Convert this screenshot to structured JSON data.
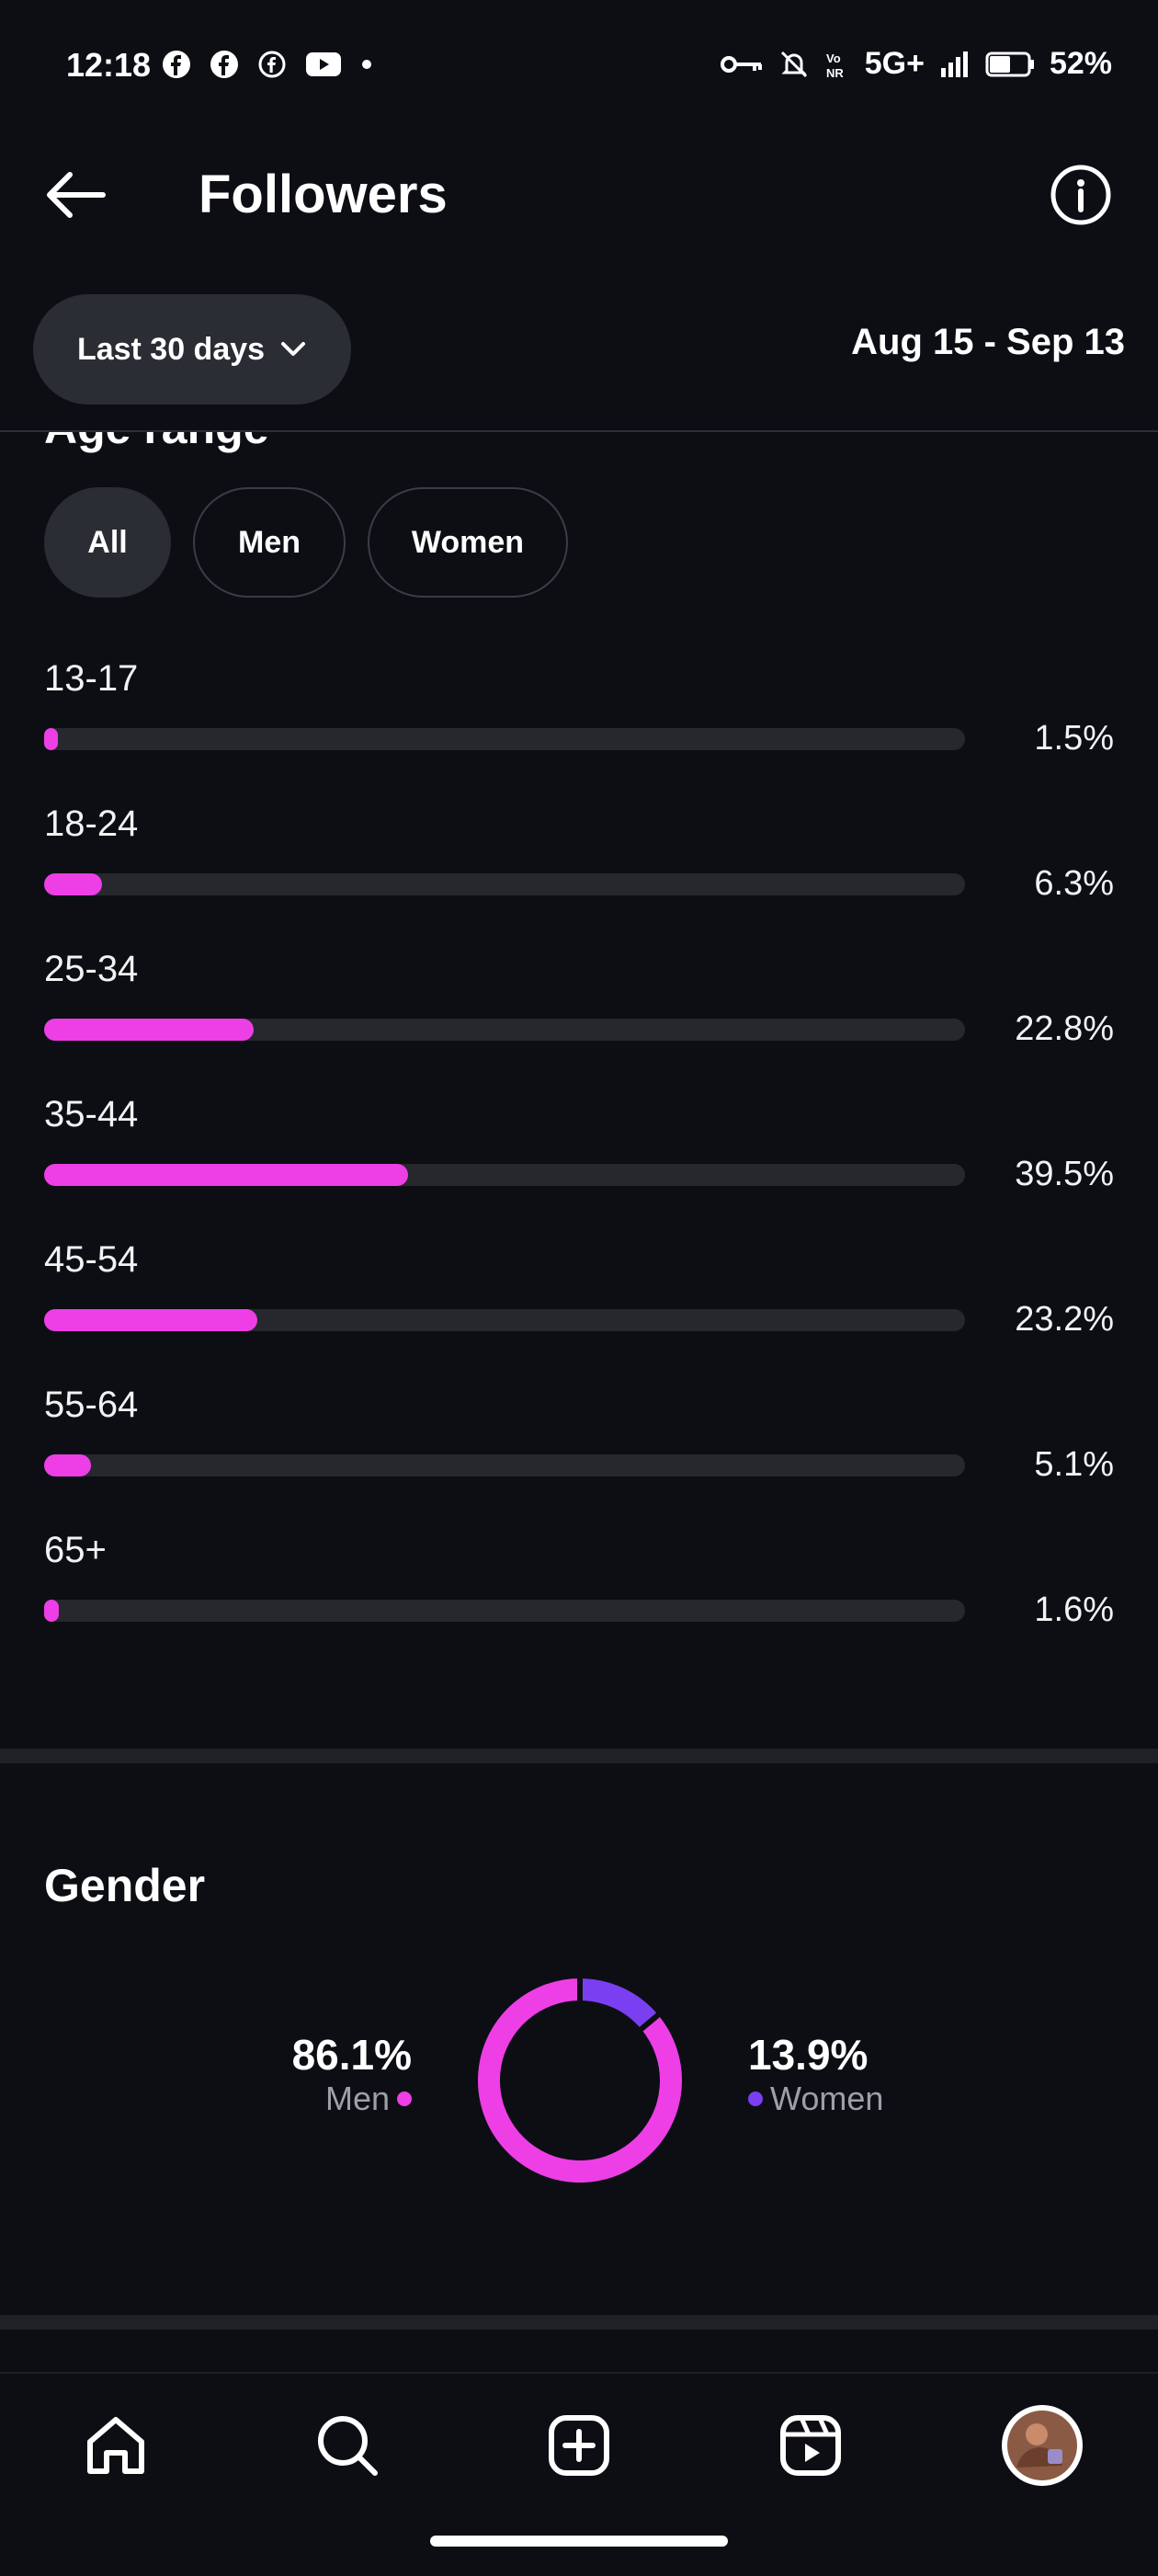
{
  "status_bar": {
    "time": "12:18",
    "network": "5G+",
    "battery": "52%",
    "icons_left": [
      "facebook-icon",
      "facebook-icon",
      "facebook-outline-icon",
      "youtube-icon",
      "dot-icon"
    ],
    "icons_right": [
      "key-icon",
      "bell-off-icon",
      "vonr-icon",
      "signal-icon",
      "battery-icon"
    ]
  },
  "header": {
    "title": "Followers"
  },
  "date_filter": {
    "label": "Last 30 days",
    "range": "Aug 15 - Sep 13"
  },
  "age_range": {
    "heading": "Age range",
    "tabs": [
      {
        "label": "All",
        "active": true
      },
      {
        "label": "Men",
        "active": false
      },
      {
        "label": "Women",
        "active": false
      }
    ],
    "rows": [
      {
        "label": "13-17",
        "value": 1.5,
        "text": "1.5%"
      },
      {
        "label": "18-24",
        "value": 6.3,
        "text": "6.3%"
      },
      {
        "label": "25-34",
        "value": 22.8,
        "text": "22.8%"
      },
      {
        "label": "35-44",
        "value": 39.5,
        "text": "39.5%"
      },
      {
        "label": "45-54",
        "value": 23.2,
        "text": "23.2%"
      },
      {
        "label": "55-64",
        "value": 5.1,
        "text": "5.1%"
      },
      {
        "label": "65+",
        "value": 1.6,
        "text": "1.6%"
      }
    ]
  },
  "gender": {
    "heading": "Gender",
    "men": {
      "value": "86.1%",
      "label": "Men",
      "fraction": 0.861
    },
    "women": {
      "value": "13.9%",
      "label": "Women",
      "fraction": 0.139
    }
  },
  "colors": {
    "accent_pink": "#ee3ee6",
    "accent_purple": "#7b3ff2",
    "background": "#0c0e14"
  },
  "bottom_nav": [
    "home-icon",
    "search-icon",
    "create-icon",
    "reels-icon",
    "profile-avatar"
  ]
}
